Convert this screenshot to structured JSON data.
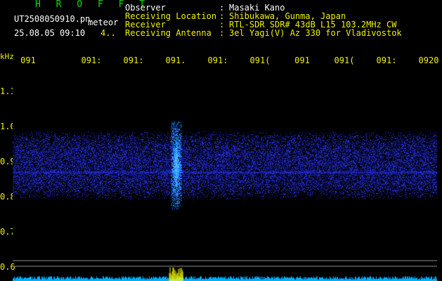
{
  "logo": "H R O F F T",
  "file_name": "UT2508050910.pn",
  "mode_label": "meteor",
  "datetime": "25.08.05 09:10",
  "duration_mark": "4..",
  "header": {
    "rows": [
      {
        "label": "Observer",
        "sep": ":",
        "value": "Masaki Kano"
      },
      {
        "label": "Receiving Location",
        "sep": ":",
        "value": "Shibukawa, Gunma, Japan"
      },
      {
        "label": "Receiver",
        "sep": ":",
        "value": "RTL-SDR SDR# 43dB L15 103.2MHz CW"
      },
      {
        "label": "Receiving Antenna",
        "sep": ":",
        "value": "3el Yagi(V) Az 330 for Vladivostok"
      }
    ]
  },
  "y_unit": "kHz",
  "time_ticks": [
    "091",
    "091:",
    "091:",
    "091.",
    "091:",
    "091(",
    "091",
    "091(",
    "091:",
    "0920"
  ],
  "freq_ticks": [
    "1.1",
    "1.0",
    "0.9",
    "0.8",
    "0.7",
    "0.6"
  ],
  "colors": {
    "text": "#f0f000",
    "label": "#ffffff",
    "logo": "#00e000",
    "noise": "#1a1aff",
    "echo": "#00d0ff",
    "spectrum": "#00b0ff",
    "spectrum_peak": "#ffff00"
  },
  "spectrogram": {
    "freq_range_khz": [
      0.55,
      1.18
    ],
    "noise_band_khz": [
      0.82,
      0.97
    ],
    "carrier_khz": 0.875,
    "meteor_echo": {
      "time_fraction": 0.385,
      "freq_khz": [
        0.77,
        1.02
      ]
    }
  }
}
